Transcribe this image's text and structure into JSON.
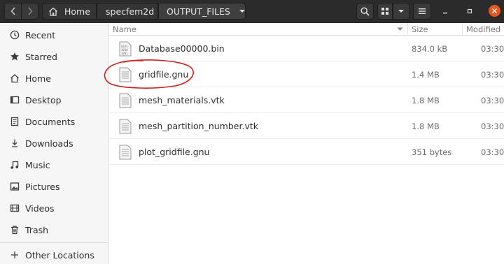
{
  "header": {
    "breadcrumbs": [
      {
        "label": "Home",
        "icon": "home-icon"
      },
      {
        "label": "specfem2d"
      },
      {
        "label": "OUTPUT_FILES",
        "icon": "chevron-down-icon"
      }
    ]
  },
  "sidebar": {
    "items": [
      {
        "label": "Recent",
        "icon": "clock-icon"
      },
      {
        "label": "Starred",
        "icon": "star-icon"
      },
      {
        "label": "Home",
        "icon": "home-icon"
      },
      {
        "label": "Desktop",
        "icon": "desktop-icon"
      },
      {
        "label": "Documents",
        "icon": "document-icon"
      },
      {
        "label": "Downloads",
        "icon": "download-icon"
      },
      {
        "label": "Music",
        "icon": "music-icon"
      },
      {
        "label": "Pictures",
        "icon": "picture-icon"
      },
      {
        "label": "Videos",
        "icon": "video-icon"
      },
      {
        "label": "Trash",
        "icon": "trash-icon"
      },
      {
        "label": "Other Locations",
        "icon": "plus-icon"
      }
    ]
  },
  "list": {
    "columns": {
      "name": "Name",
      "size": "Size",
      "modified": "Modified"
    },
    "files": [
      {
        "name": "Database00000.bin",
        "size": "834.0 kB",
        "modified": "03:30",
        "icon": "binary-file-icon"
      },
      {
        "name": "gridfile.gnu",
        "size": "1.4 MB",
        "modified": "03:30",
        "icon": "text-file-icon"
      },
      {
        "name": "mesh_materials.vtk",
        "size": "1.8 MB",
        "modified": "03:30",
        "icon": "text-file-icon"
      },
      {
        "name": "mesh_partition_number.vtk",
        "size": "1.8 MB",
        "modified": "03:30",
        "icon": "text-file-icon"
      },
      {
        "name": "plot_gridfile.gnu",
        "size": "351 bytes",
        "modified": "03:30",
        "icon": "text-file-icon"
      }
    ]
  },
  "colors": {
    "headerbar": "#2b2b2b",
    "sidebar": "#f6f6f6",
    "close_button": "#e9541f",
    "annotation": "#d11f1f"
  }
}
